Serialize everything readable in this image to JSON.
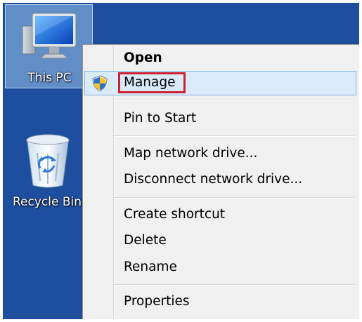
{
  "desktop": {
    "icons": [
      {
        "label": "This PC",
        "icon": "computer-monitor-icon"
      },
      {
        "label": "Recycle Bin",
        "icon": "recycle-bin-icon"
      }
    ],
    "background_color": "#1e4f9e"
  },
  "context_menu": {
    "items": [
      {
        "label": "Open",
        "default": true
      },
      {
        "label": "Manage",
        "icon": "uac-shield-icon",
        "highlighted": true
      },
      {
        "label": "Pin to Start"
      },
      {
        "label": "Map network drive..."
      },
      {
        "label": "Disconnect network drive..."
      },
      {
        "label": "Create shortcut"
      },
      {
        "label": "Delete"
      },
      {
        "label": "Rename"
      },
      {
        "label": "Properties"
      }
    ],
    "highlight_color": "#d0202e",
    "hover_color": "#d9eaf8"
  }
}
